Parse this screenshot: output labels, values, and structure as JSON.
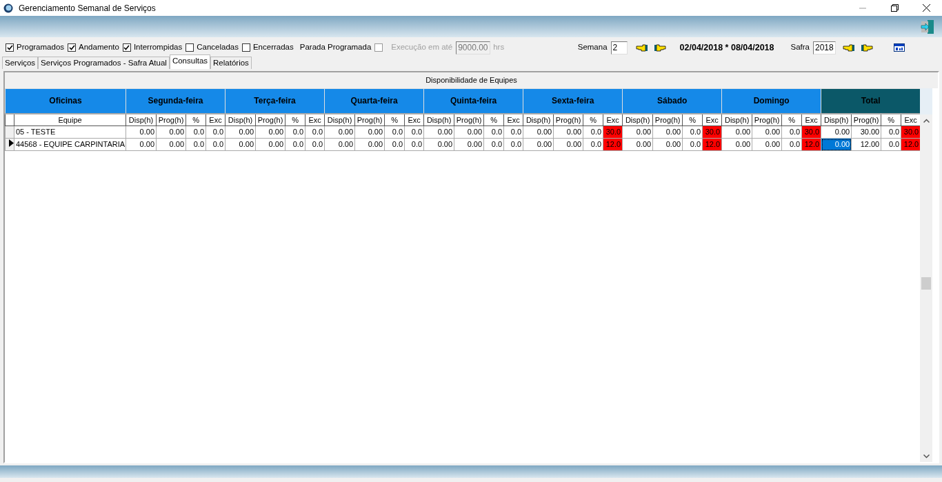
{
  "window": {
    "title": "Gerenciamento Semanal de Serviços"
  },
  "filters": [
    {
      "label": "Programados",
      "checked": true
    },
    {
      "label": "Andamento",
      "checked": true
    },
    {
      "label": "Interrompidas",
      "checked": true
    },
    {
      "label": "Canceladas",
      "checked": false
    },
    {
      "label": "Encerradas",
      "checked": false
    }
  ],
  "parada": {
    "label": "Parada Programada",
    "checked": false
  },
  "execucao": {
    "label": "Execução em até",
    "value": "9000.00",
    "unit": "hrs",
    "disabled": true
  },
  "semana": {
    "label": "Semana",
    "value": "2"
  },
  "date_range": "02/04/2018 * 08/04/2018",
  "safra": {
    "label": "Safra",
    "value": "2018"
  },
  "tabs": [
    {
      "label": "Serviços",
      "selected": false
    },
    {
      "label": "Serviços Programados - Safra Atual",
      "selected": false
    },
    {
      "label": "Consultas",
      "selected": true
    },
    {
      "label": "Relatórios",
      "selected": false
    }
  ],
  "panel_title": "Disponibilidade de Equipes",
  "groups": [
    {
      "label": "Oficinas",
      "kind": "team"
    },
    {
      "label": "Segunda-feira",
      "kind": "day"
    },
    {
      "label": "Terça-feira",
      "kind": "day"
    },
    {
      "label": "Quarta-feira",
      "kind": "day"
    },
    {
      "label": "Quinta-feira",
      "kind": "day"
    },
    {
      "label": "Sexta-feira",
      "kind": "day"
    },
    {
      "label": "Sábado",
      "kind": "day"
    },
    {
      "label": "Domingo",
      "kind": "day"
    },
    {
      "label": "Total",
      "kind": "total"
    }
  ],
  "columns": [
    "Equipe",
    "Disp(h)",
    "Prog(h)",
    "%",
    "Exc",
    "Disp(h)",
    "Prog(h)",
    "%",
    "Exc",
    "Disp(h)",
    "Prog(h)",
    "%",
    "Exc",
    "Disp(h)",
    "Prog(h)",
    "%",
    "Exc",
    "Disp(h)",
    "Prog(h)",
    "%",
    "Exc",
    "Disp(h)",
    "Prog(h)",
    "%",
    "Exc",
    "Disp(h)",
    "Prog(h)",
    "%",
    "Exc",
    "Disp(h)",
    "Prog(h)",
    "%",
    "Exc"
  ],
  "rows": [
    {
      "selected": false,
      "team": "05 - TESTE",
      "cells": [
        {
          "text": "0.00",
          "alert": false,
          "selected": false
        },
        {
          "text": "0.00",
          "alert": false,
          "selected": false
        },
        {
          "text": "0.0",
          "alert": false,
          "selected": false
        },
        {
          "text": "0.0",
          "alert": false,
          "selected": false
        },
        {
          "text": "0.00",
          "alert": false,
          "selected": false
        },
        {
          "text": "0.00",
          "alert": false,
          "selected": false
        },
        {
          "text": "0.0",
          "alert": false,
          "selected": false
        },
        {
          "text": "0.0",
          "alert": false,
          "selected": false
        },
        {
          "text": "0.00",
          "alert": false,
          "selected": false
        },
        {
          "text": "0.00",
          "alert": false,
          "selected": false
        },
        {
          "text": "0.0",
          "alert": false,
          "selected": false
        },
        {
          "text": "0.0",
          "alert": false,
          "selected": false
        },
        {
          "text": "0.00",
          "alert": false,
          "selected": false
        },
        {
          "text": "0.00",
          "alert": false,
          "selected": false
        },
        {
          "text": "0.0",
          "alert": false,
          "selected": false
        },
        {
          "text": "0.0",
          "alert": false,
          "selected": false
        },
        {
          "text": "0.00",
          "alert": false,
          "selected": false
        },
        {
          "text": "0.00",
          "alert": false,
          "selected": false
        },
        {
          "text": "0.0",
          "alert": false,
          "selected": false
        },
        {
          "text": "30.0",
          "alert": true,
          "selected": false
        },
        {
          "text": "0.00",
          "alert": false,
          "selected": false
        },
        {
          "text": "0.00",
          "alert": false,
          "selected": false
        },
        {
          "text": "0.0",
          "alert": false,
          "selected": false
        },
        {
          "text": "30.0",
          "alert": true,
          "selected": false
        },
        {
          "text": "0.00",
          "alert": false,
          "selected": false
        },
        {
          "text": "0.00",
          "alert": false,
          "selected": false
        },
        {
          "text": "0.0",
          "alert": false,
          "selected": false
        },
        {
          "text": "30.0",
          "alert": true,
          "selected": false
        },
        {
          "text": "0.00",
          "alert": false,
          "selected": false
        },
        {
          "text": "30.00",
          "alert": false,
          "selected": false
        },
        {
          "text": "0.0",
          "alert": false,
          "selected": false
        },
        {
          "text": "30.0",
          "alert": true,
          "selected": false
        }
      ]
    },
    {
      "selected": true,
      "team": "44568 - EQUIPE CARPINTARIA",
      "cells": [
        {
          "text": "0.00",
          "alert": false,
          "selected": false
        },
        {
          "text": "0.00",
          "alert": false,
          "selected": false
        },
        {
          "text": "0.0",
          "alert": false,
          "selected": false
        },
        {
          "text": "0.0",
          "alert": false,
          "selected": false
        },
        {
          "text": "0.00",
          "alert": false,
          "selected": false
        },
        {
          "text": "0.00",
          "alert": false,
          "selected": false
        },
        {
          "text": "0.0",
          "alert": false,
          "selected": false
        },
        {
          "text": "0.0",
          "alert": false,
          "selected": false
        },
        {
          "text": "0.00",
          "alert": false,
          "selected": false
        },
        {
          "text": "0.00",
          "alert": false,
          "selected": false
        },
        {
          "text": "0.0",
          "alert": false,
          "selected": false
        },
        {
          "text": "0.0",
          "alert": false,
          "selected": false
        },
        {
          "text": "0.00",
          "alert": false,
          "selected": false
        },
        {
          "text": "0.00",
          "alert": false,
          "selected": false
        },
        {
          "text": "0.0",
          "alert": false,
          "selected": false
        },
        {
          "text": "0.0",
          "alert": false,
          "selected": false
        },
        {
          "text": "0.00",
          "alert": false,
          "selected": false
        },
        {
          "text": "0.00",
          "alert": false,
          "selected": false
        },
        {
          "text": "0.0",
          "alert": false,
          "selected": false
        },
        {
          "text": "12.0",
          "alert": true,
          "selected": false
        },
        {
          "text": "0.00",
          "alert": false,
          "selected": false
        },
        {
          "text": "0.00",
          "alert": false,
          "selected": false
        },
        {
          "text": "0.0",
          "alert": false,
          "selected": false
        },
        {
          "text": "12.0",
          "alert": true,
          "selected": false
        },
        {
          "text": "0.00",
          "alert": false,
          "selected": false
        },
        {
          "text": "0.00",
          "alert": false,
          "selected": false
        },
        {
          "text": "0.0",
          "alert": false,
          "selected": false
        },
        {
          "text": "12.0",
          "alert": true,
          "selected": false
        },
        {
          "text": "0.00",
          "alert": false,
          "selected": true
        },
        {
          "text": "12.00",
          "alert": false,
          "selected": false
        },
        {
          "text": "0.0",
          "alert": false,
          "selected": false
        },
        {
          "text": "12.0",
          "alert": true,
          "selected": false
        }
      ]
    }
  ]
}
